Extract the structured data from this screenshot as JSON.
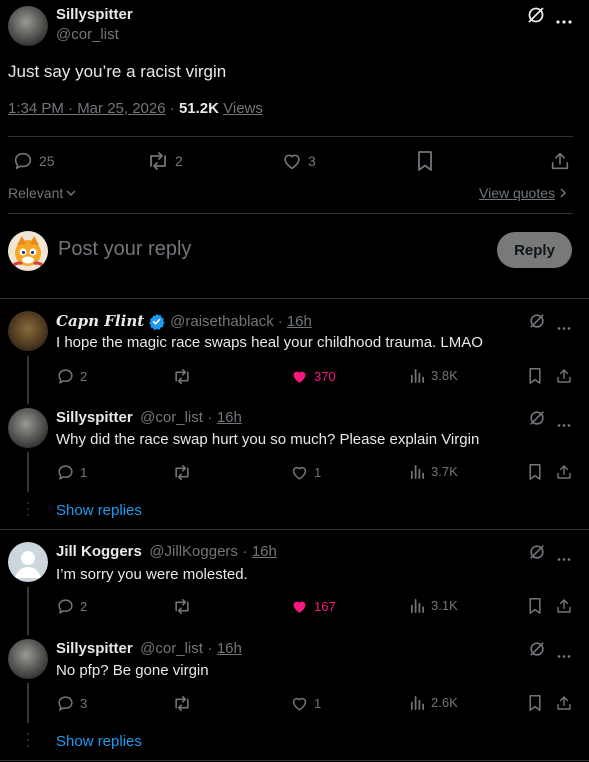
{
  "main_post": {
    "name": "Sillyspitter",
    "handle": "@cor_list",
    "text": "Just say you’re a racist virgin",
    "time": "1:34 PM · Mar 25, 2026",
    "separator": "·",
    "views_count": "51.2K",
    "views_label": "Views",
    "replies": "25",
    "reposts": "2",
    "likes": "3"
  },
  "filter": {
    "sort_label": "Relevant",
    "view_quotes_label": "View quotes"
  },
  "composer": {
    "placeholder": "Post your reply",
    "reply_button": "Reply"
  },
  "replies": [
    {
      "name": "Capn Flint",
      "handle": "@raisethablack",
      "time": "16h",
      "text": "I hope the magic race swaps heal your childhood trauma. LMAO",
      "replies": "2",
      "reposts": "",
      "likes": "370",
      "views": "3.8K"
    },
    {
      "name": "Sillyspitter",
      "handle": "@cor_list",
      "time": "16h",
      "text": "Why did the race swap hurt you so much? Please explain Virgin",
      "replies": "1",
      "reposts": "",
      "likes": "1",
      "views": "3.7K"
    },
    {
      "name": "Jill Koggers",
      "handle": "@JillKoggers",
      "time": "16h",
      "text": "I’m sorry you were molested.",
      "replies": "2",
      "reposts": "",
      "likes": "167",
      "views": "3.1K"
    },
    {
      "name": "Sillyspitter",
      "handle": "@cor_list",
      "time": "16h",
      "text": "No pfp? Be gone virgin",
      "replies": "3",
      "reposts": "",
      "likes": "1",
      "views": "2.6K"
    }
  ],
  "show_replies_label": "Show replies",
  "dot": "·",
  "colors": {
    "background": "#000000",
    "text": "#e7e9ea",
    "muted": "#71767b",
    "accent": "#1d9bf0",
    "like_pink": "#f91880",
    "divider": "#2f3336",
    "verified": "#1d9bf0"
  }
}
